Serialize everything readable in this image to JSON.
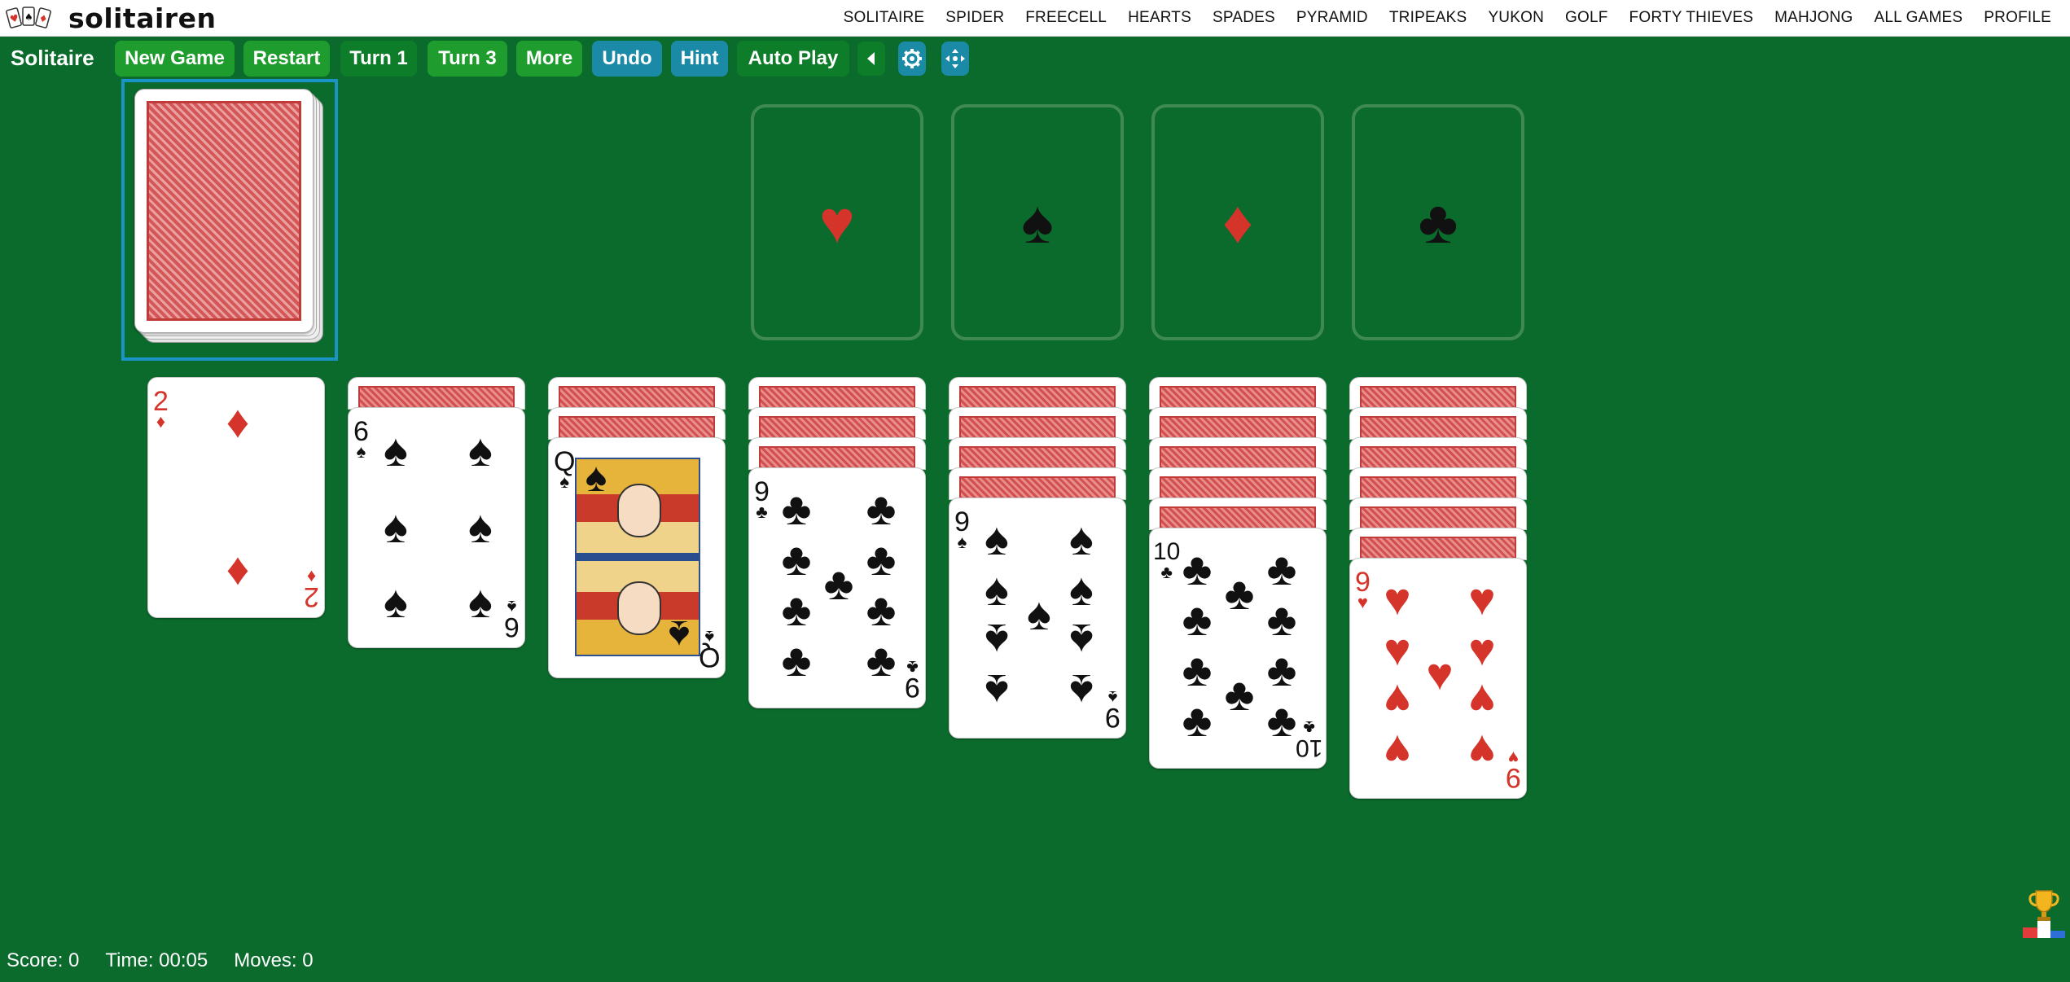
{
  "brand": {
    "name": "solitairen"
  },
  "nav": [
    "SOLITAIRE",
    "SPIDER",
    "FREECELL",
    "HEARTS",
    "SPADES",
    "PYRAMID",
    "TRIPEAKS",
    "YUKON",
    "GOLF",
    "FORTY THIEVES",
    "MAHJONG",
    "ALL GAMES",
    "PROFILE"
  ],
  "toolbar": {
    "title": "Solitaire",
    "new_game": "New Game",
    "restart": "Restart",
    "turn1": "Turn 1",
    "turn3": "Turn 3",
    "more": "More",
    "undo": "Undo",
    "hint": "Hint",
    "auto_play": "Auto Play",
    "icons": [
      "sound-icon",
      "settings-icon",
      "move-icon"
    ]
  },
  "foundations": [
    {
      "suit": "hearts",
      "symbol": "♥",
      "color": "#d5342b"
    },
    {
      "suit": "spades",
      "symbol": "♠",
      "color": "#111111"
    },
    {
      "suit": "diamonds",
      "symbol": "♦",
      "color": "#d5342b"
    },
    {
      "suit": "clubs",
      "symbol": "♣",
      "color": "#111111"
    }
  ],
  "tableau": [
    {
      "hidden": 0,
      "top": {
        "rank": "2",
        "suit": "♦",
        "color": "red"
      }
    },
    {
      "hidden": 1,
      "top": {
        "rank": "6",
        "suit": "♠",
        "color": "black"
      }
    },
    {
      "hidden": 2,
      "top": {
        "rank": "Q",
        "suit": "♠",
        "color": "black"
      }
    },
    {
      "hidden": 3,
      "top": {
        "rank": "9",
        "suit": "♣",
        "color": "black"
      }
    },
    {
      "hidden": 4,
      "top": {
        "rank": "9",
        "suit": "♠",
        "color": "black"
      }
    },
    {
      "hidden": 5,
      "top": {
        "rank": "10",
        "suit": "♣",
        "color": "black"
      }
    },
    {
      "hidden": 6,
      "top": {
        "rank": "9",
        "suit": "♥",
        "color": "red"
      }
    }
  ],
  "status": {
    "score": "Score: 0",
    "time": "Time: 00:05",
    "moves": "Moves: 0"
  },
  "colors": {
    "felt": "#0a6b2c",
    "button_green": "#1f9c2e",
    "button_blue": "#1b8aa7",
    "selection": "#1a93c7",
    "card_back": "#d15050"
  }
}
